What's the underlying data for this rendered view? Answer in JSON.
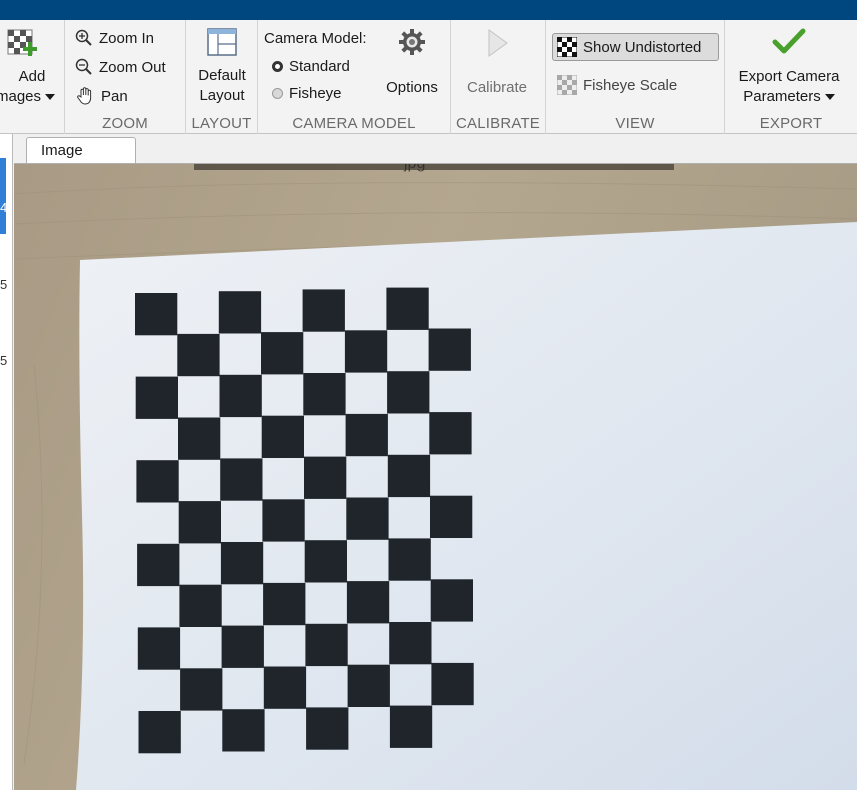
{
  "ribbon": {
    "file": {
      "add_images_line1": "Add",
      "add_images_line2": "mages",
      "section_label": ""
    },
    "zoom": {
      "zoom_in": "Zoom In",
      "zoom_out": "Zoom Out",
      "pan": "Pan",
      "section_label": "ZOOM"
    },
    "layout": {
      "default_layout_line1": "Default",
      "default_layout_line2": "Layout",
      "section_label": "LAYOUT"
    },
    "camera_model": {
      "heading": "Camera Model:",
      "standard": "Standard",
      "fisheye": "Fisheye",
      "selected": "Standard",
      "options": "Options",
      "section_label": "CAMERA MODEL"
    },
    "calibrate": {
      "calibrate": "Calibrate",
      "section_label": "CALIBRATE"
    },
    "view": {
      "show_undistorted": "Show Undistorted",
      "fisheye_scale": "Fisheye Scale",
      "section_label": "VIEW"
    },
    "export": {
      "line1": "Export Camera",
      "line2": "Parameters",
      "section_label": "EXPORT"
    }
  },
  "left_panel": {
    "fragments": [
      "4",
      "5",
      "5"
    ]
  },
  "tabs": [
    {
      "label": "Image",
      "active": true
    }
  ],
  "image": {
    "title_fragment": "jpg",
    "content": "checkerboard calibration pattern on paper"
  },
  "colors": {
    "titlebar": "#00467f",
    "accent_blue": "#2f7fd6",
    "check_green": "#4aa02c",
    "checker_dark": "#1f252b"
  },
  "icons": {
    "add_images": "add-images-icon",
    "zoom_in": "zoom-in-icon",
    "zoom_out": "zoom-out-icon",
    "pan": "hand-pan-icon",
    "layout": "layout-grid-icon",
    "options": "gear-icon",
    "calibrate": "play-icon",
    "undistorted": "checkerboard-icon",
    "fisheye_scale": "checkerboard-faded-icon",
    "export": "checkmark-icon"
  }
}
